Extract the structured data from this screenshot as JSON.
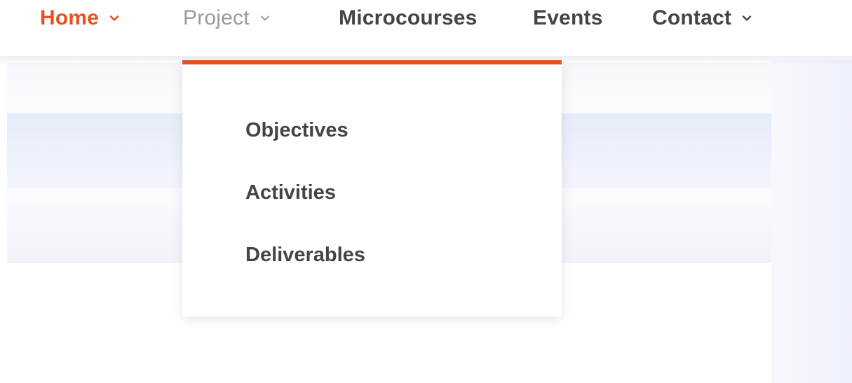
{
  "nav": {
    "items": [
      {
        "label": "Home",
        "has_dropdown": true,
        "state": "active"
      },
      {
        "label": "Project",
        "has_dropdown": true,
        "state": "hovered"
      },
      {
        "label": "Microcourses",
        "has_dropdown": false,
        "state": "normal"
      },
      {
        "label": "Events",
        "has_dropdown": false,
        "state": "normal"
      },
      {
        "label": "Contact",
        "has_dropdown": true,
        "state": "normal"
      }
    ],
    "dropdown_icon": "chevron-down-icon"
  },
  "dropdown": {
    "parent": "Project",
    "items": [
      {
        "label": "Objectives"
      },
      {
        "label": "Activities"
      },
      {
        "label": "Deliverables"
      }
    ]
  },
  "colors": {
    "accent": "#e8501f",
    "text": "#444444",
    "hover_text": "#9a9a9a"
  }
}
